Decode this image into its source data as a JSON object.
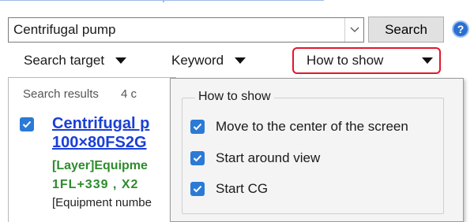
{
  "search": {
    "value": "Centrifugal pump",
    "button_label": "Search",
    "help_label": "?"
  },
  "toolbar": {
    "search_target": "Search target",
    "keyword": "Keyword",
    "how_to_show": "How to show"
  },
  "results": {
    "header_label": "Search results",
    "count_text": "4 c",
    "item": {
      "title_line1": "Centrifugal p",
      "title_line2": "100×80FS2G",
      "layer_line1": "[Layer]Equipme",
      "layer_line2": "1FL+339 , X2",
      "equipment_line": "[Equipment numbe"
    }
  },
  "popup": {
    "group_title": "How to show",
    "options": [
      {
        "label": "Move to the center of the screen",
        "checked": true
      },
      {
        "label": "Start around view",
        "checked": true
      },
      {
        "label": "Start CG",
        "checked": true
      }
    ]
  },
  "colors": {
    "accent": "#2b7ad6",
    "highlight_border": "#e0182c",
    "link": "#1a3fd6",
    "layer_text": "#2d8c2d"
  },
  "icons": [
    "help-icon",
    "chevron-down-icon",
    "dropdown-arrow-icon",
    "checkbox-checked-icon"
  ]
}
